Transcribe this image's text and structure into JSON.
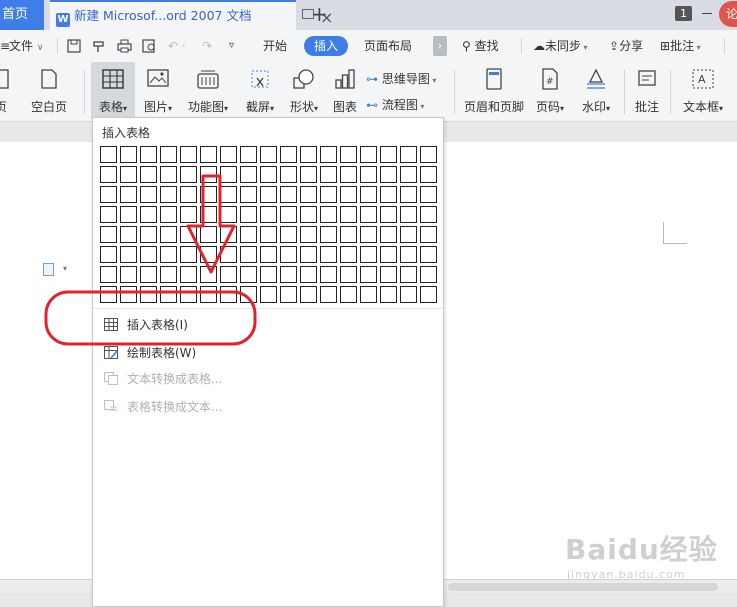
{
  "tabs": {
    "home": "首页",
    "document": "新建 Microsof...ord 2007 文档",
    "window_count": "1",
    "login_partial": "论"
  },
  "menubar": {
    "file": "文件",
    "items": [
      "开始",
      "插入",
      "页面布局"
    ],
    "active": "插入",
    "search": "查找",
    "sync": "未同步",
    "share": "分享",
    "comment": "批注"
  },
  "ribbon": {
    "page_partial": "页",
    "blank_page": "空白页",
    "table": "表格",
    "picture": "图片",
    "function_chart": "功能图",
    "screenshot": "截屏",
    "shape": "形状",
    "chart": "图表",
    "mindmap": "思维导图",
    "flowchart": "流程图",
    "header_footer": "页眉和页脚",
    "page_number": "页码",
    "watermark": "水印",
    "comment": "批注",
    "textbox": "文本框"
  },
  "dropdown": {
    "title": "插入表格",
    "grid_cols": 17,
    "grid_rows": 8,
    "items": [
      {
        "label": "插入表格(I)",
        "enabled": true
      },
      {
        "label": "绘制表格(W)",
        "enabled": true
      },
      {
        "label": "文本转换成表格...",
        "enabled": false
      },
      {
        "label": "表格转换成文本...",
        "enabled": false
      }
    ]
  },
  "annotation_color": "#e0232d",
  "watermark": {
    "main": "Baidu经验",
    "sub": "jingyan.baidu.com"
  }
}
